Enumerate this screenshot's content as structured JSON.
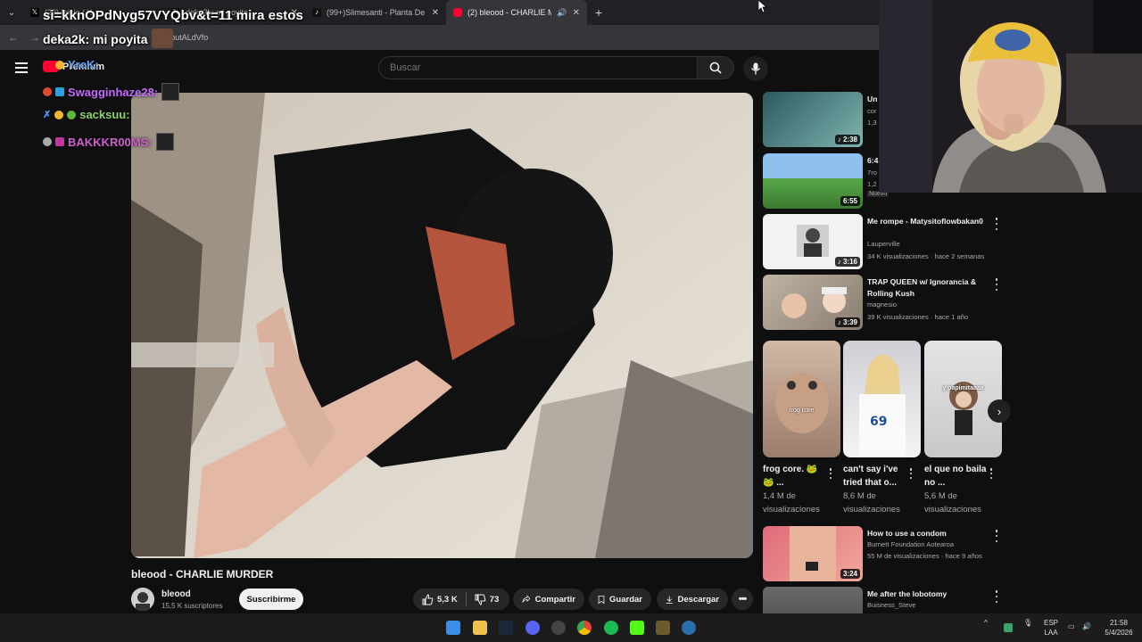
{
  "browser": {
    "tabs": [
      {
        "label": "(29) Inicio / X",
        "icon": "x-logo-icon",
        "active": false
      },
      {
        "label": "deka2k: mi poyita",
        "icon": "x-logo-icon",
        "active": false
      },
      {
        "label": "(99+)Slimesanti - Planta De La",
        "icon": "tiktok-icon",
        "active": false
      },
      {
        "label": "(2) bleood - CHARLIE MURDER",
        "icon": "youtube-icon",
        "active": true
      }
    ],
    "url": "=oabutALdVfo"
  },
  "overlay": {
    "line1": "si=kknOPdNyg57VYQbv&t=11 mira estos",
    "line2": "deka2k: mi poyita",
    "chat": [
      {
        "name": "YrcK:",
        "color": "#5fa8ff"
      },
      {
        "name": "Swagginhaze28:",
        "color": "#c46bff"
      },
      {
        "name": "sacksuu:",
        "color": "#8fd36a"
      },
      {
        "name": "BAKKKR00MS:",
        "color": "#d05fd0"
      }
    ]
  },
  "youtube": {
    "brand_label": "Premium",
    "search_placeholder": "Buscar",
    "video": {
      "title": "bleood - CHARLIE MURDER",
      "channel": "bleood",
      "subscribers": "15,5 K suscriptores",
      "subscribe_label": "Suscribirme",
      "likes": "5,3 K",
      "dislikes": "73",
      "share_label": "Compartir",
      "save_label": "Guardar",
      "download_label": "Descargar"
    },
    "sidebar": [
      {
        "title": "Un",
        "channel": "cor",
        "meta": "1,3",
        "duration": "2:38",
        "thumb": "#3c6a6e"
      },
      {
        "title": "6:4",
        "channel": "7ro",
        "meta": "1,2",
        "duration": "6:55",
        "badge": "Nuevo",
        "thumb": "#6fa0d8"
      },
      {
        "title": "Me rompe - Matysitoflowbakan0",
        "channel": "Lauperville",
        "meta": "34 K visualizaciones · hace 2 semanas",
        "duration": "3:16",
        "thumb": "#e8e8e8"
      },
      {
        "title": "TRAP QUEEN w/ Ignorancia & Rolling Kush",
        "channel": "magnesio",
        "meta": "39 K visualizaciones · hace 1 año",
        "duration": "3:39",
        "thumb": "#a89a8c"
      },
      {
        "title": "How to use a condom",
        "channel": "Burnett Foundation Aotearoa",
        "meta": "55 M de visualizaciones · hace 9 años",
        "duration": "3:24",
        "thumb": "#d9736f"
      },
      {
        "title": "Me after the lobotomy",
        "channel": "Buisness_Steve",
        "meta": "",
        "duration": "",
        "thumb": "#777"
      }
    ],
    "shorts": [
      {
        "title": "frog core. 🐸🐸 ...",
        "views": "1,4 M de visualizaciones",
        "overlay": "frog core",
        "thumb": "#b89a86"
      },
      {
        "title": "can't say i've tried that o...",
        "views": "8,6 M de visualizaciones",
        "overlay": "",
        "thumb": "#e9e7ea"
      },
      {
        "title": "el que no baila no ...",
        "views": "5,6 M de visualizaciones",
        "overlay": "y papimitaaaa",
        "thumb": "#d6d6d6"
      }
    ]
  },
  "taskbar": {
    "lang": "ESP",
    "region": "LAA",
    "time": "21:58",
    "date": "5/4/2026"
  }
}
